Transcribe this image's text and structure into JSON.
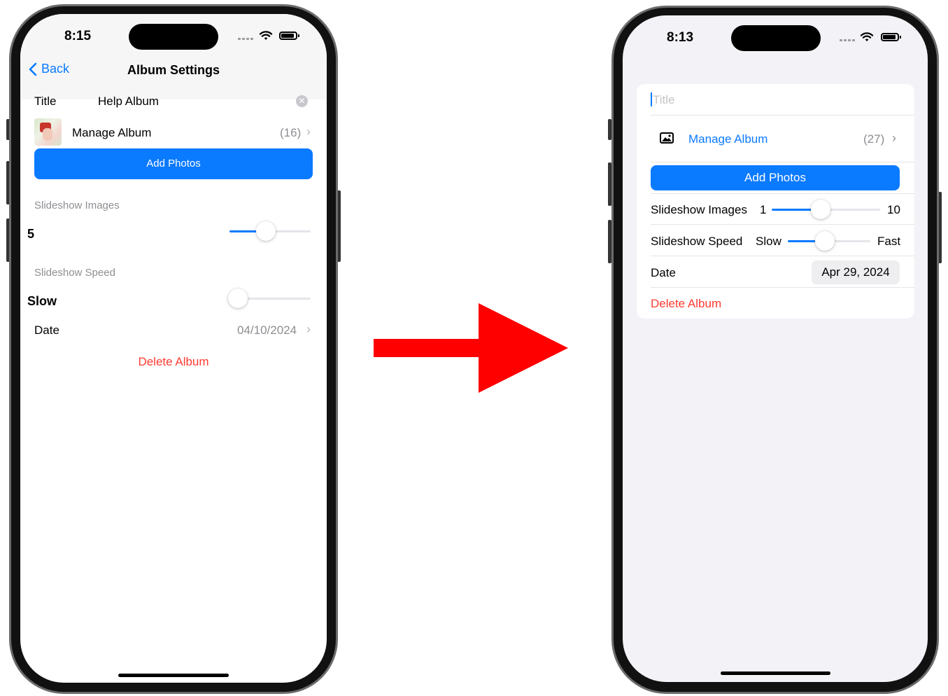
{
  "left": {
    "status_time": "8:15",
    "nav": {
      "back_label": "Back",
      "title": "Album Settings"
    },
    "title_row": {
      "label": "Title",
      "value": "Help Album"
    },
    "manage": {
      "label": "Manage Album",
      "count": "(16)"
    },
    "add_photos_label": "Add Photos",
    "slideshow_images": {
      "header": "Slideshow Images",
      "value": "5",
      "level": 0.45
    },
    "slideshow_speed": {
      "header": "Slideshow Speed",
      "value": "Slow",
      "level": 0.0
    },
    "date": {
      "label": "Date",
      "value": "04/10/2024"
    },
    "delete_label": "Delete Album"
  },
  "right": {
    "status_time": "8:13",
    "title_placeholder": "Title",
    "manage": {
      "label": "Manage Album",
      "count": "(27)"
    },
    "add_photos_label": "Add Photos",
    "slideshow_images": {
      "label": "Slideshow Images",
      "min": "1",
      "max": "10",
      "level": 0.45
    },
    "slideshow_speed": {
      "label": "Slideshow Speed",
      "min": "Slow",
      "max": "Fast",
      "level": 0.45
    },
    "date": {
      "label": "Date",
      "value": "Apr 29, 2024"
    },
    "delete_label": "Delete Album"
  },
  "colors": {
    "accent": "#0a7aff",
    "destructive": "#ff3b30",
    "arrow": "#ff0000",
    "grouped_bg": "#f2f2f7"
  },
  "icons": [
    "back-chevron-icon",
    "clear-icon",
    "chevron-right-icon",
    "photo-icon",
    "wifi-icon",
    "battery-icon",
    "signal-icon"
  ]
}
